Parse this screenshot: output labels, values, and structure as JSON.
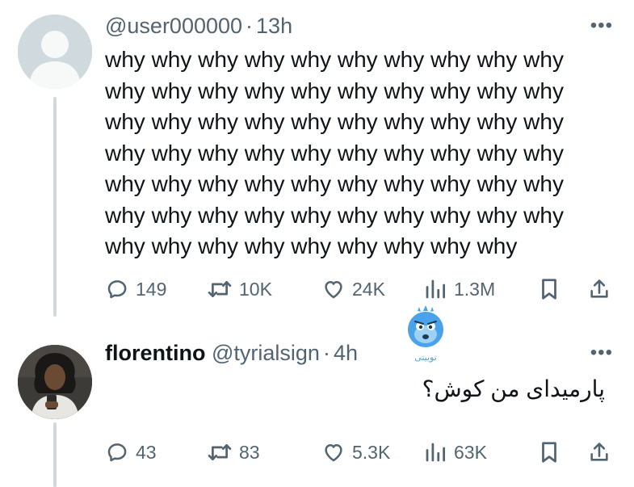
{
  "tweet1": {
    "handle": "@user000000",
    "separator": "·",
    "time": "13h",
    "more_label": "•••",
    "text_lines": [
      "why why why why why why why why why why",
      "why why why why why why why why why why",
      "why why why why why why why why why why",
      "why why why why why why why why why why",
      "why why why why why why why why why why",
      "why why why why why why why why why why",
      "why why why why why why why why why"
    ],
    "actions": {
      "replies": "149",
      "retweets": "10K",
      "likes": "24K",
      "views": "1.3M"
    }
  },
  "tweet2": {
    "display_name": "florentino",
    "handle": "@tyrialsign",
    "separator": "·",
    "time": "4h",
    "more_label": "•••",
    "text": "پارمیدای من کوش؟",
    "actions": {
      "replies": "43",
      "retweets": "83",
      "likes": "5.3K",
      "views": "63K"
    }
  },
  "watermark": {
    "label": "توییتی"
  },
  "colors": {
    "text_primary": "#0f1419",
    "text_secondary": "#536471",
    "thread_line": "#cfd9de",
    "avatar_placeholder": "#cfd9de",
    "watermark_blue": "#4aa3ea"
  },
  "icons": [
    "default-avatar-icon",
    "more-icon",
    "reply-icon",
    "retweet-icon",
    "like-icon",
    "views-icon",
    "bookmark-icon",
    "share-icon",
    "mascot-icon"
  ]
}
